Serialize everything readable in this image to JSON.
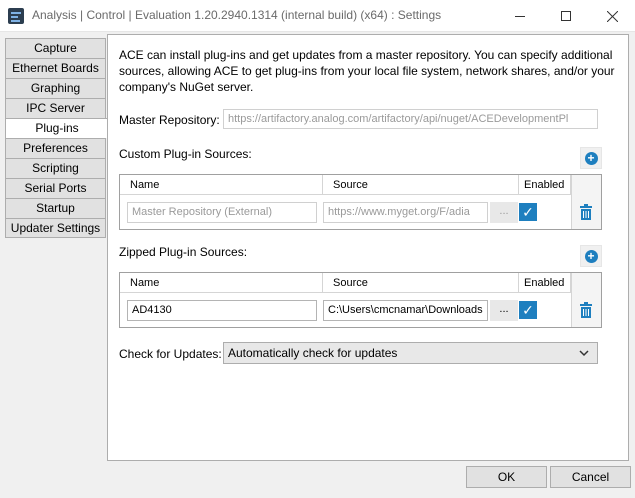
{
  "window": {
    "title": "Analysis | Control | Evaluation 1.20.2940.1314 (internal build) (x64) : Settings"
  },
  "nav": {
    "items": [
      {
        "label": "Capture"
      },
      {
        "label": "Ethernet Boards"
      },
      {
        "label": "Graphing"
      },
      {
        "label": "IPC Server"
      },
      {
        "label": "Plug-ins",
        "active": true
      },
      {
        "label": "Preferences"
      },
      {
        "label": "Scripting"
      },
      {
        "label": "Serial Ports"
      },
      {
        "label": "Startup"
      },
      {
        "label": "Updater Settings"
      }
    ]
  },
  "plugins": {
    "description": "ACE can install plug-ins and get updates from a master repository.  You can specify additional sources, allowing ACE to get plug-ins from your local file system, network shares, and/or your company's NuGet server.",
    "master_repo_label": "Master Repository:",
    "master_repo_value": "https://artifactory.analog.com/artifactory/api/nuget/ACEDevelopmentPl",
    "custom_label": "Custom Plug-in Sources:",
    "zipped_label": "Zipped Plug-in Sources:",
    "columns": {
      "name": "Name",
      "source": "Source",
      "enabled": "Enabled"
    },
    "custom_rows": [
      {
        "name": "Master Repository (External)",
        "source": "https://www.myget.org/F/adia",
        "browse": "...",
        "enabled": true
      }
    ],
    "zipped_rows": [
      {
        "name": "AD4130",
        "source": "C:\\Users\\cmcnamar\\Downloads",
        "browse": "...",
        "enabled": true
      }
    ],
    "check_updates_label": "Check for Updates:",
    "check_updates_value": "Automatically check for updates"
  },
  "footer": {
    "ok_label": "OK",
    "cancel_label": "Cancel"
  },
  "colors": {
    "accent": "#1e7fbf"
  },
  "icons": {
    "add": "plus-circle-icon",
    "delete": "trash-icon",
    "check": "checkmark-icon",
    "dropdown": "chevron-down-icon"
  }
}
